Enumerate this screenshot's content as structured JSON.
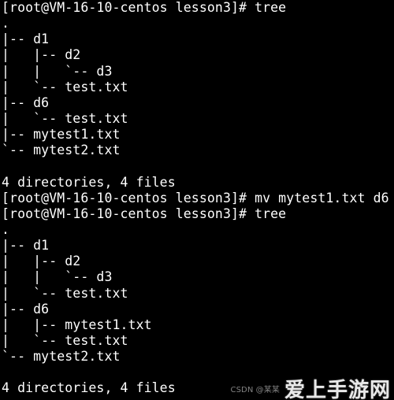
{
  "terminal": {
    "lines": [
      "[root@VM-16-10-centos lesson3]# tree",
      ".",
      "|-- d1",
      "|   |-- d2",
      "|   |   `-- d3",
      "|   `-- test.txt",
      "|-- d6",
      "|   `-- test.txt",
      "|-- mytest1.txt",
      "`-- mytest2.txt",
      "",
      "4 directories, 4 files",
      "[root@VM-16-10-centos lesson3]# mv mytest1.txt d6",
      "[root@VM-16-10-centos lesson3]# tree",
      ".",
      "|-- d1",
      "|   |-- d2",
      "|   |   `-- d3",
      "|   `-- test.txt",
      "|-- d6",
      "|   |-- mytest1.txt",
      "|   `-- test.txt",
      "`-- mytest2.txt",
      "",
      "4 directories, 4 files"
    ]
  },
  "watermark": {
    "small_text": "CSDN @某某",
    "logo_text": "爱上手游网"
  }
}
